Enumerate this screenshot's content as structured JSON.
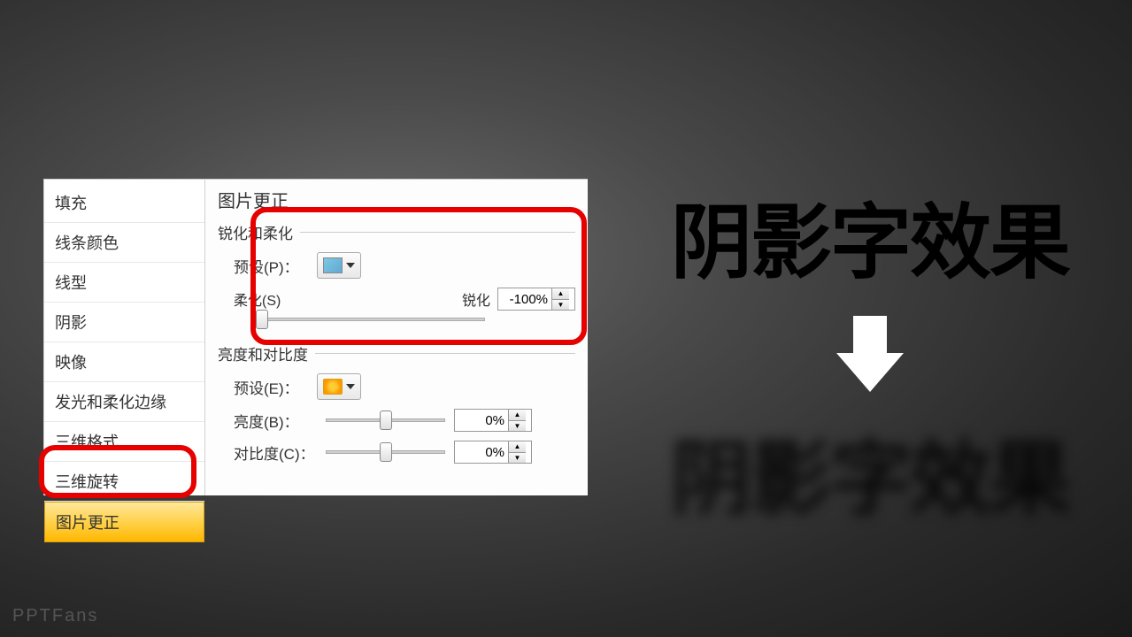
{
  "sidebar": {
    "items": [
      {
        "label": "填充"
      },
      {
        "label": "线条颜色"
      },
      {
        "label": "线型"
      },
      {
        "label": "阴影"
      },
      {
        "label": "映像"
      },
      {
        "label": "发光和柔化边缘"
      },
      {
        "label": "三维格式"
      },
      {
        "label": "三维旋转"
      },
      {
        "label": "图片更正"
      }
    ]
  },
  "panel": {
    "title": "图片更正",
    "sharpenGroup": {
      "title": "锐化和柔化",
      "presetLabel": "预设(P)：",
      "softenLabel": "柔化(S)",
      "sharpenLabel": "锐化",
      "value": "-100%"
    },
    "brightnessGroup": {
      "title": "亮度和对比度",
      "presetLabel": "预设(E)：",
      "brightnessLabel": "亮度(B)：",
      "contrastLabel": "对比度(C)：",
      "brightnessValue": "0%",
      "contrastValue": "0%"
    }
  },
  "effect": {
    "text": "阴影字效果"
  },
  "watermark": "PPTFans"
}
